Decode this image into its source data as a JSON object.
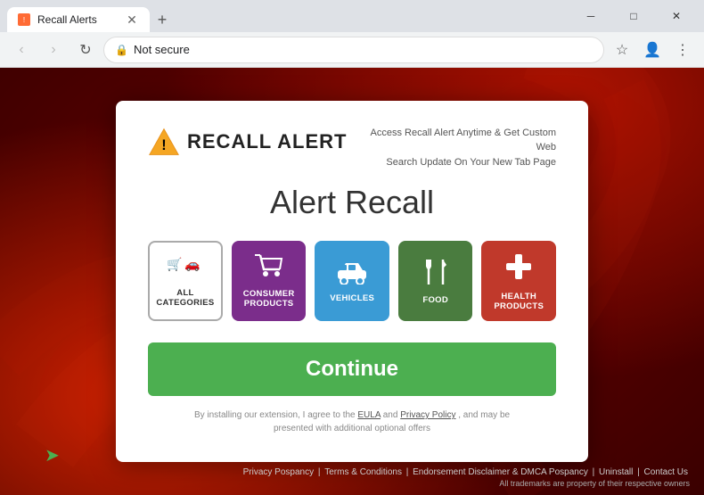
{
  "browser": {
    "tab_title": "Recall Alerts",
    "new_tab_icon": "+",
    "url": "Not secure",
    "url_full": "Not secure",
    "back_icon": "‹",
    "forward_icon": "›",
    "refresh_icon": "↺",
    "bookmark_icon": "☆",
    "profile_icon": "👤",
    "menu_icon": "⋮",
    "win_minimize": "─",
    "win_restore": "□",
    "win_close": "✕"
  },
  "modal": {
    "logo_text": "RECALL ALERT",
    "tagline": "Access Recall Alert Anytime & Get Custom Web\nSearch Update On Your New Tab Page",
    "hero_title": "Alert Recall",
    "categories": [
      {
        "id": "all-categories",
        "label": "ALL\nCATEGORIES",
        "icon": "🛒🚗",
        "icon_alt": "🛒"
      },
      {
        "id": "consumer-products",
        "label": "CONSUMER\nPRODUCTS",
        "icon": "🛒"
      },
      {
        "id": "vehicles",
        "label": "VEHICLES",
        "icon": "🚗"
      },
      {
        "id": "food",
        "label": "FOOD",
        "icon": "🍴"
      },
      {
        "id": "health-products",
        "label": "HEALTH\nPRODUCTS",
        "icon": "➕"
      }
    ],
    "continue_label": "Continue",
    "fine_print": "By installing our extension, I agree to the",
    "fine_print_eula": "EULA",
    "fine_print_and": "and",
    "fine_print_privacy": "Privacy Policy",
    "fine_print_suffix": ", and may be\npresented with additional optional offers"
  },
  "footer": {
    "links": [
      "Privacy Pospancy",
      "Terms & Conditions",
      "Endorsement Disclaimer & DMCA Pospancy",
      "Uninstall",
      "Contact Us"
    ],
    "trademark": "All trademarks are property of their respective owners"
  }
}
